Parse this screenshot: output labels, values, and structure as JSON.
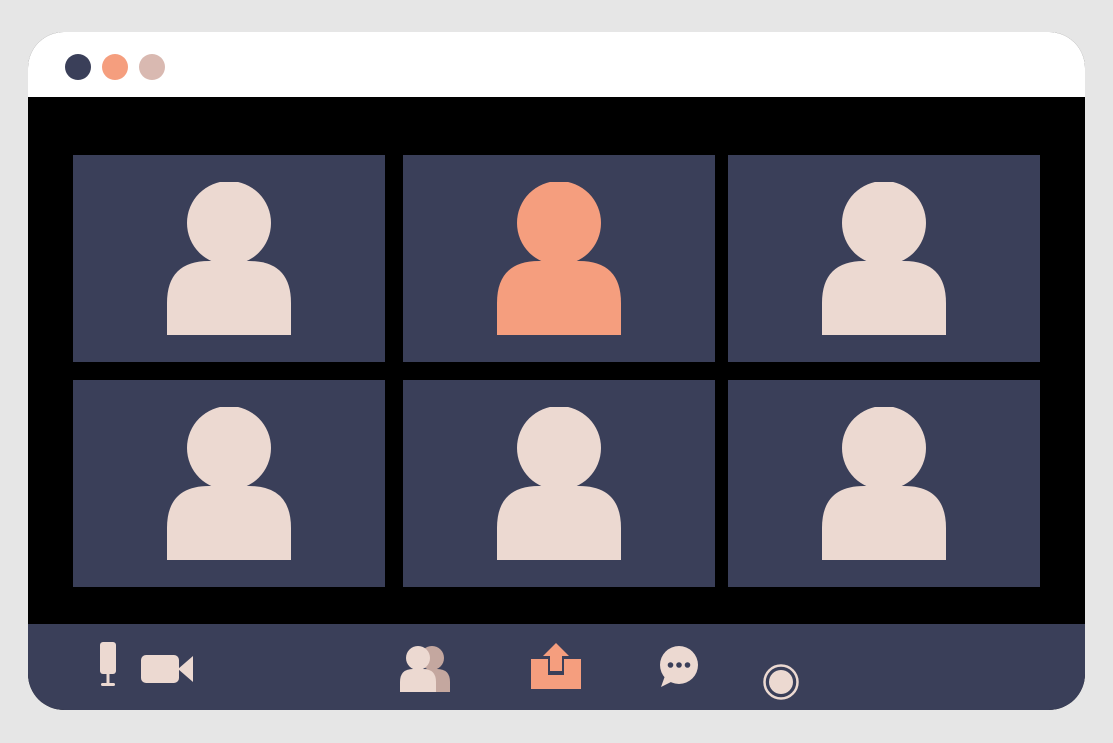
{
  "window": {
    "controls": [
      {
        "name": "close",
        "color": "#3a3f59"
      },
      {
        "name": "minimize",
        "color": "#f59e7e"
      },
      {
        "name": "maximize",
        "color": "#d9b9b1"
      }
    ]
  },
  "participants": [
    {
      "tile": 1,
      "avatar_color": "#ecd9d1",
      "active_speaker": false
    },
    {
      "tile": 2,
      "avatar_color": "#f59e7e",
      "active_speaker": true
    },
    {
      "tile": 3,
      "avatar_color": "#ecd9d1",
      "active_speaker": false
    },
    {
      "tile": 4,
      "avatar_color": "#ecd9d1",
      "active_speaker": false
    },
    {
      "tile": 5,
      "avatar_color": "#ecd9d1",
      "active_speaker": false
    },
    {
      "tile": 6,
      "avatar_color": "#ecd9d1",
      "active_speaker": false
    }
  ],
  "toolbar": {
    "buttons": [
      {
        "name": "microphone-button",
        "icon": "microphone-icon",
        "color": "#ecd9d1"
      },
      {
        "name": "camera-button",
        "icon": "video-camera-icon",
        "color": "#ecd9d1"
      },
      {
        "name": "participants-button",
        "icon": "participants-icon",
        "color": "#ecd9d1"
      },
      {
        "name": "share-screen-button",
        "icon": "share-screen-icon",
        "color": "#f59e7e"
      },
      {
        "name": "chat-button",
        "icon": "chat-icon",
        "color": "#ecd9d1"
      },
      {
        "name": "record-button",
        "icon": "record-icon",
        "color": "#ecd9d1"
      }
    ]
  },
  "colors": {
    "page_background": "#e6e6e6",
    "titlebar": "#ffffff",
    "frame": "#000000",
    "tile_background": "#3a3f59",
    "toolbar_background": "#3a3f59",
    "avatar": "#ecd9d1",
    "accent": "#f59e7e"
  }
}
